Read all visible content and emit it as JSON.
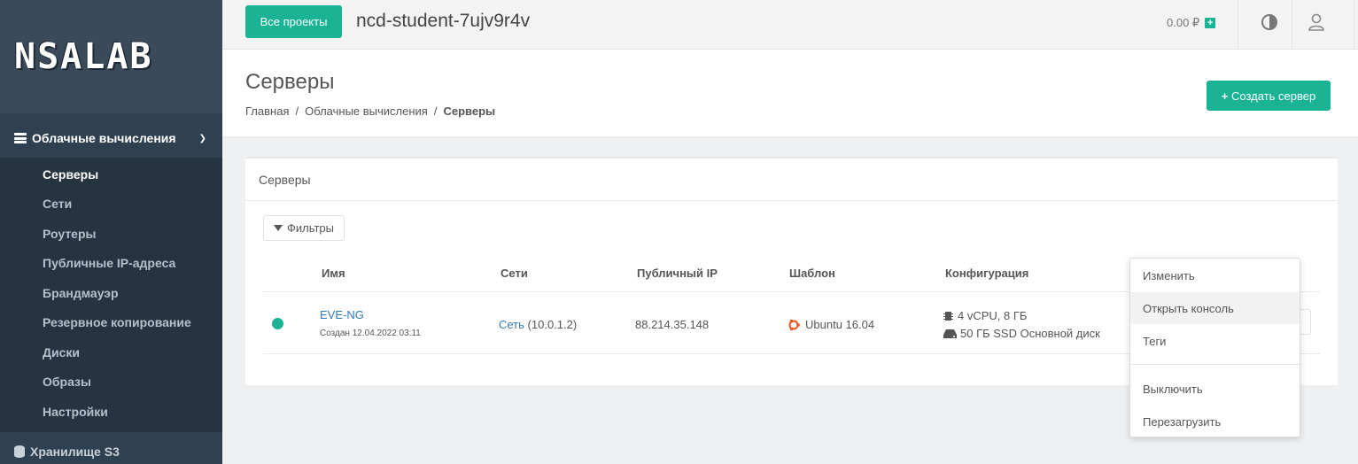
{
  "sidebar": {
    "logo": "NSALAB",
    "section_label": "Облачные вычисления",
    "section_icon": "server-icon",
    "items": [
      {
        "label": "Серверы",
        "active": true
      },
      {
        "label": "Сети"
      },
      {
        "label": "Роутеры"
      },
      {
        "label": "Публичные IP-адреса"
      },
      {
        "label": "Брандмауэр"
      },
      {
        "label": "Резервное копирование"
      },
      {
        "label": "Диски"
      },
      {
        "label": "Образы"
      },
      {
        "label": "Настройки"
      }
    ],
    "storage_label": "Хранилище S3",
    "storage_icon": "database-icon"
  },
  "topbar": {
    "projects_button": "Все проекты",
    "project_name": "ncd-student-7ujv9r4v",
    "balance": "0.00 ₽",
    "add_funds_icon": "plus-square-icon",
    "theme_icon": "contrast-icon",
    "user_icon": "user-icon"
  },
  "page": {
    "title": "Серверы",
    "breadcrumb": [
      "Главная",
      "Облачные вычисления",
      "Серверы"
    ],
    "create_button": "Создать сервер"
  },
  "panel": {
    "title": "Серверы",
    "filter_button": "Фильтры",
    "columns": [
      "Имя",
      "Сети",
      "Публичный IP",
      "Шаблон",
      "Конфигурация"
    ],
    "rows": [
      {
        "status": "running",
        "name": "EVE-NG",
        "created": "Создан 12.04.2022 03:11",
        "network_link": "Сеть",
        "network_ip": "(10.0.1.2)",
        "public_ip": "88.214.35.148",
        "template": "Ubuntu 16.04",
        "config_cpu": "4 vCPU, 8 ГБ",
        "config_disk": "50 ГБ SSD Основной диск"
      }
    ]
  },
  "dropdown": {
    "items": [
      "Изменить",
      "Открыть консоль",
      "Теги",
      "Выключить",
      "Перезагрузить"
    ],
    "hovered": "Открыть консоль"
  },
  "colors": {
    "accent": "#1ab394",
    "sidebar": "#2f4050",
    "link": "#337ab7"
  }
}
